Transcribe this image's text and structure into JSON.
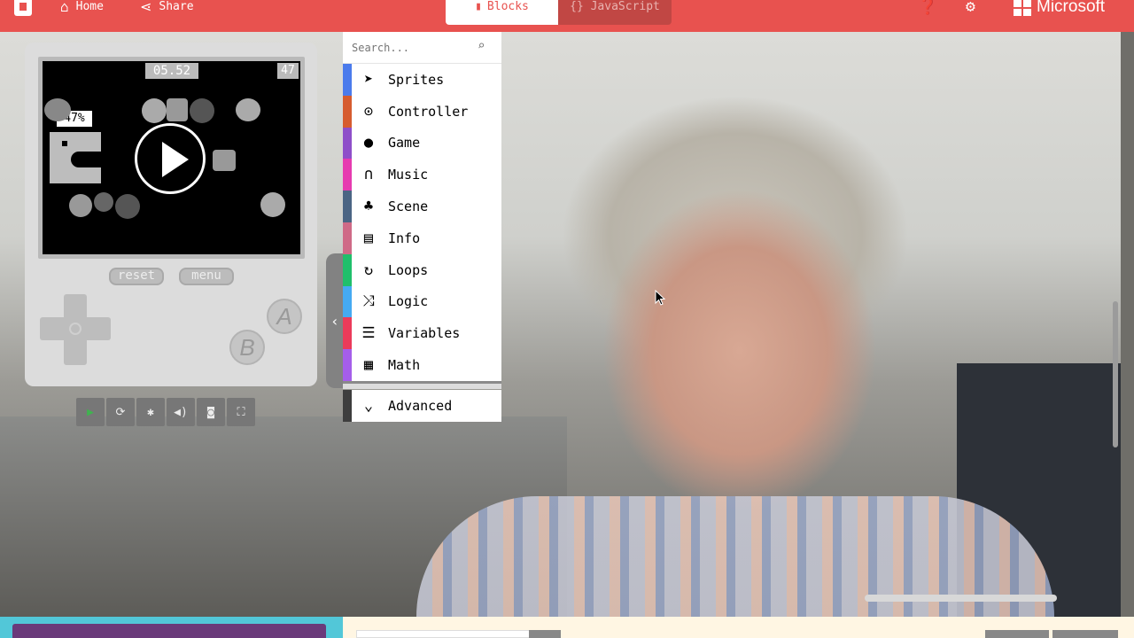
{
  "topbar": {
    "home_label": "Home",
    "share_label": "Share",
    "blocks_label": "Blocks",
    "javascript_label": "{} JavaScript",
    "brand": "Microsoft"
  },
  "simulator": {
    "timer": "05.52",
    "score": "47",
    "progress": "47%",
    "reset_label": "reset",
    "menu_label": "menu",
    "a_label": "A",
    "b_label": "B"
  },
  "toolbox": {
    "search_placeholder": "Search...",
    "categories": [
      {
        "label": "Sprites",
        "color": "#4b7bec",
        "icon": "paper-plane-icon"
      },
      {
        "label": "Controller",
        "color": "#d65c2f",
        "icon": "gamepad-icon"
      },
      {
        "label": "Game",
        "color": "#8e4fc9",
        "icon": "circle-icon"
      },
      {
        "label": "Music",
        "color": "#e63bb0",
        "icon": "headphones-icon"
      },
      {
        "label": "Scene",
        "color": "#4b6584",
        "icon": "tree-icon"
      },
      {
        "label": "Info",
        "color": "#cf6a87",
        "icon": "id-card-icon"
      },
      {
        "label": "Loops",
        "color": "#20bf6b",
        "icon": "refresh-icon"
      },
      {
        "label": "Logic",
        "color": "#45aaf2",
        "icon": "shuffle-icon"
      },
      {
        "label": "Variables",
        "color": "#eb3b5a",
        "icon": "list-icon"
      },
      {
        "label": "Math",
        "color": "#a55eea",
        "icon": "calculator-icon"
      }
    ],
    "advanced_label": "Advanced"
  },
  "colors": {
    "header": "#e8524f",
    "bottom_left": "#52c7d8",
    "bottom_button": "#6a3a7a"
  }
}
